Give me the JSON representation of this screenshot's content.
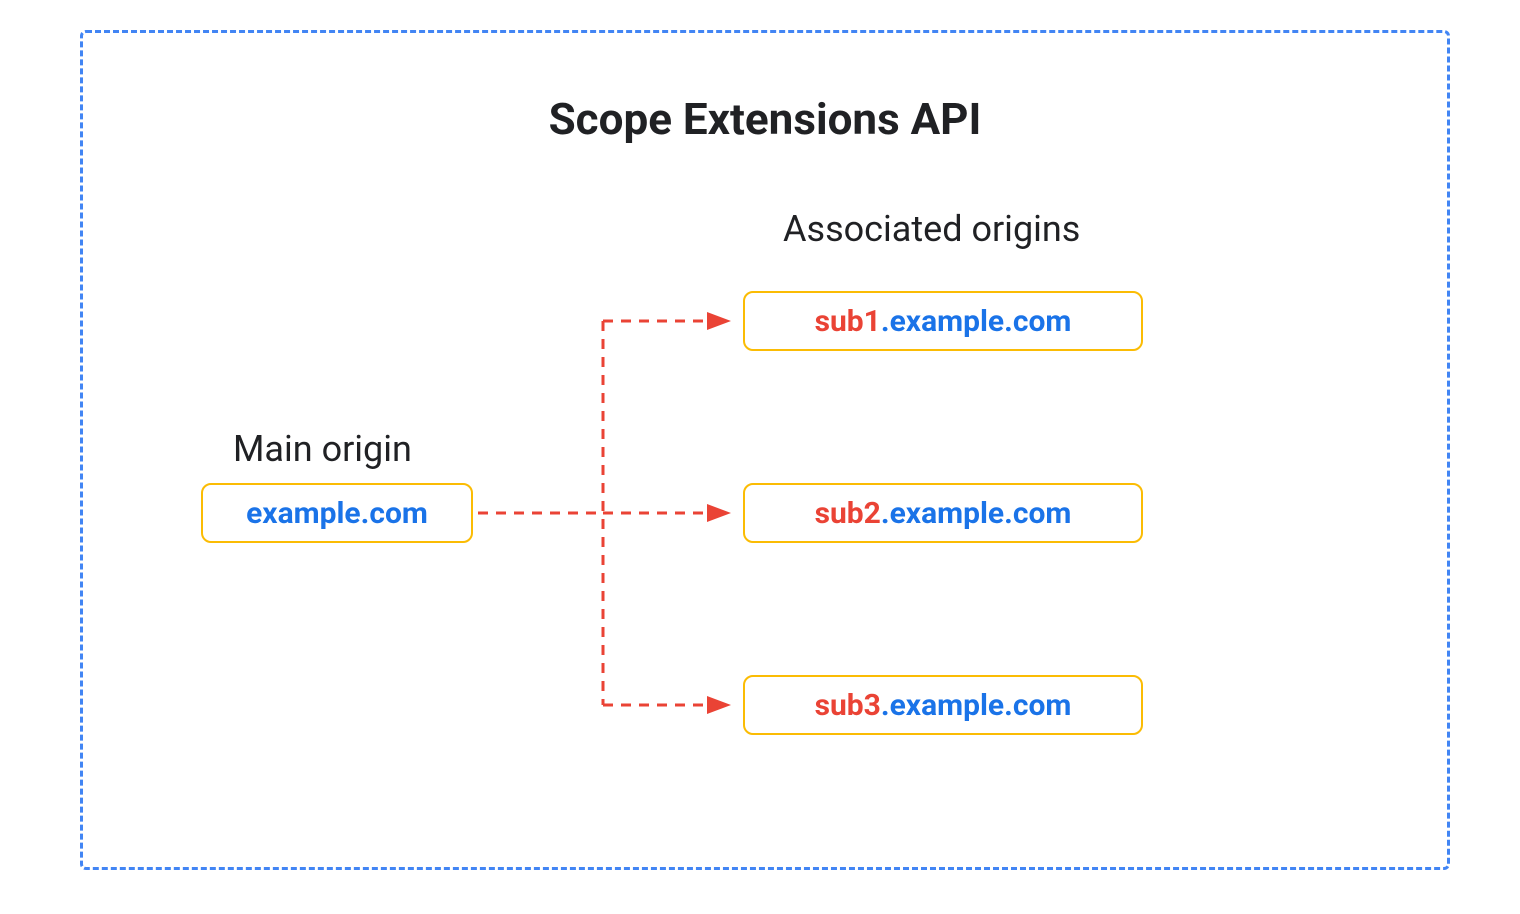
{
  "title": "Scope Extensions API",
  "main_origin": {
    "label": "Main origin",
    "value": "example.com"
  },
  "associated": {
    "label": "Associated origins",
    "items": [
      {
        "sub": "sub1",
        "rest": ".example.com"
      },
      {
        "sub": "sub2",
        "rest": ".example.com"
      },
      {
        "sub": "sub3",
        "rest": ".example.com"
      }
    ]
  },
  "colors": {
    "border_dashed": "#4285f4",
    "box_border": "#fbbc04",
    "arrow": "#ea4335",
    "text_blue": "#1a73e8",
    "text_red": "#ea4335"
  }
}
